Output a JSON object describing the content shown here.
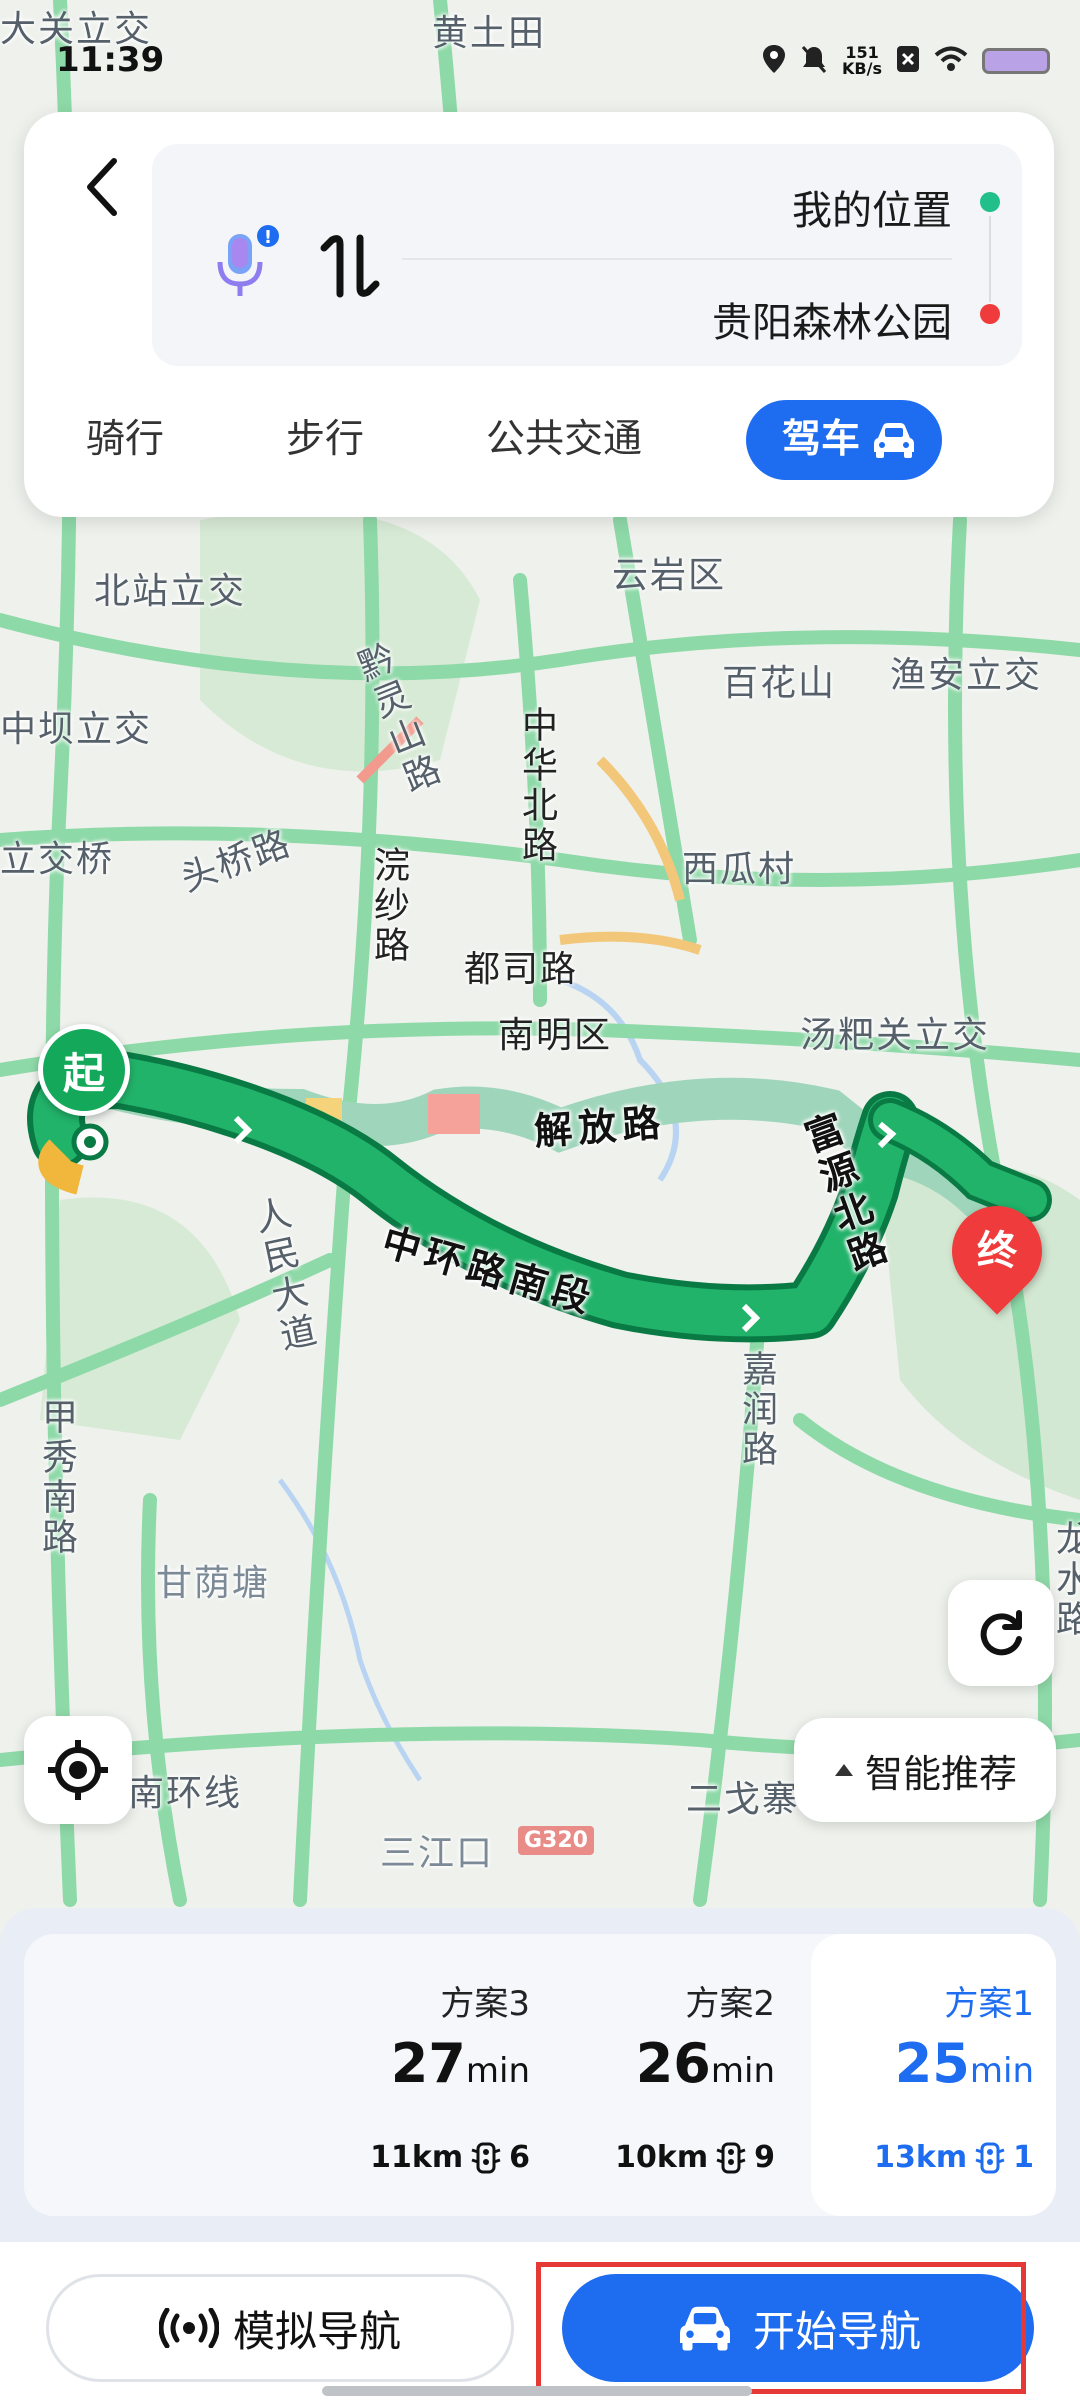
{
  "status_bar": {
    "time": "11:39",
    "net_speed_value": "151",
    "net_speed_unit": "KB/s"
  },
  "map": {
    "labels": [
      "大关立交",
      "黄土田",
      "北站立交",
      "云岩区",
      "百花山",
      "渔安立交",
      "中坝立交",
      "立交桥",
      "头桥路",
      "西瓜村",
      "都司路",
      "南明区",
      "汤粑关立交",
      "甘荫塘",
      "南环线",
      "三江口",
      "二戈寨"
    ],
    "vertical_labels": [
      "黔灵山路",
      "中华北路",
      "浣纱路",
      "人民大道",
      "甲秀南路",
      "嘉润路",
      "龙水路"
    ],
    "road_names": {
      "jiefang": "解放路",
      "zhonghuan": "中环路南段",
      "fuyuan": "富源北路"
    },
    "highway_badge": "G320",
    "start_marker": "起",
    "end_marker": "终"
  },
  "route_card": {
    "origin": "我的位置",
    "destination": "贵阳森林公园",
    "modes": {
      "cycling": "骑行",
      "walking": "步行",
      "transit": "公共交通",
      "driving": "驾车"
    }
  },
  "map_buttons": {
    "smart_recommend": "智能推荐"
  },
  "plans": [
    {
      "name": "方案3",
      "time": "27",
      "unit": "min",
      "distance": "11km",
      "lights": "6"
    },
    {
      "name": "方案2",
      "time": "26",
      "unit": "min",
      "distance": "10km",
      "lights": "9"
    },
    {
      "name": "方案1",
      "time": "25",
      "unit": "min",
      "distance": "13km",
      "lights": "1"
    }
  ],
  "actions": {
    "simulate": "模拟导航",
    "start": "开始导航"
  },
  "colors": {
    "accent": "#1e6cf0",
    "route_green": "#0f9d58",
    "origin_dot": "#21c08b",
    "dest_dot": "#ef3b3b"
  },
  "icons": {
    "back": "back-arrow-icon",
    "voice": "microphone-icon",
    "swap": "swap-icon",
    "car": "car-icon",
    "locate": "locate-icon",
    "refresh": "refresh-icon",
    "traffic_light": "traffic-light-icon",
    "broadcast": "broadcast-icon"
  }
}
